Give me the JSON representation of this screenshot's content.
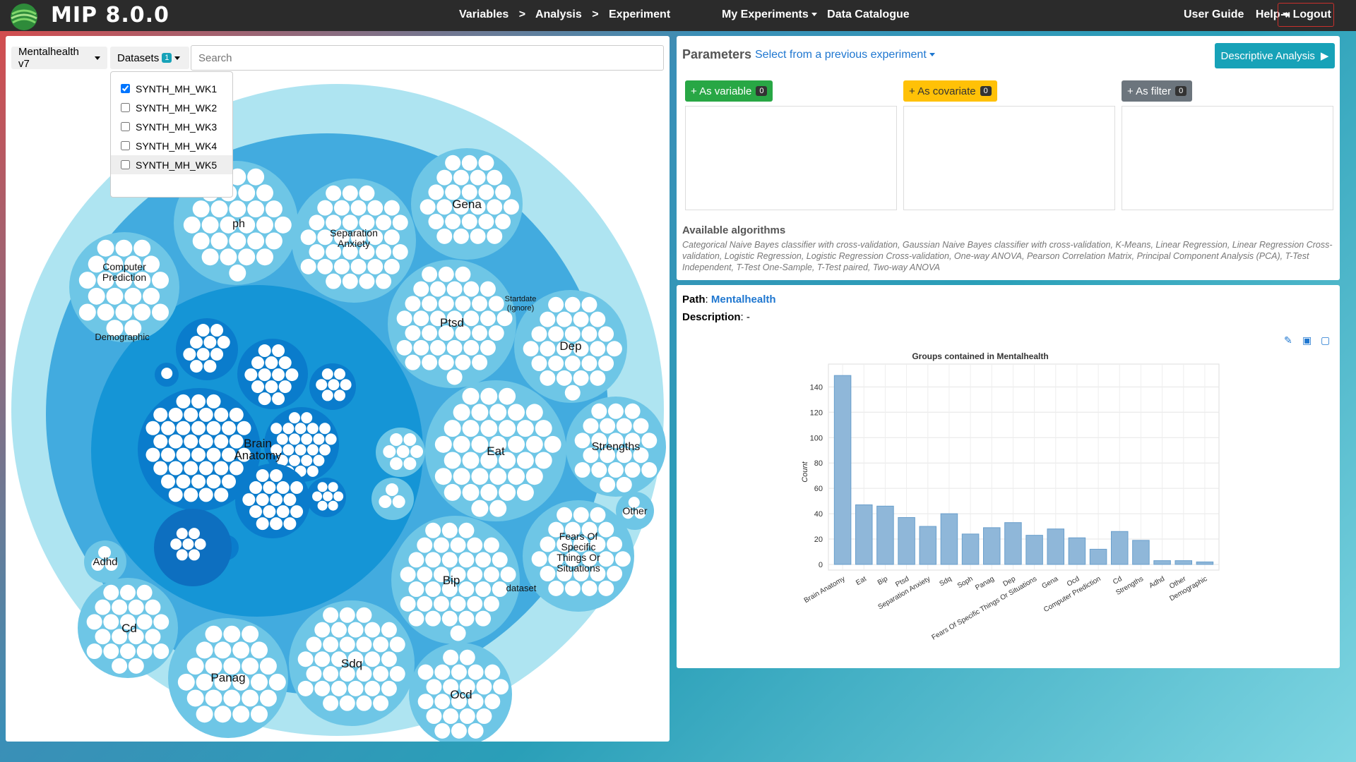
{
  "nav": {
    "brand": "MIP 8.0.0",
    "crumb_variables": "Variables",
    "crumb_sep1": ">",
    "crumb_analysis": "Analysis",
    "crumb_sep2": ">",
    "crumb_experiment": "Experiment",
    "my_experiments": "My Experiments",
    "data_catalogue": "Data Catalogue",
    "user_guide": "User Guide",
    "help": "Help",
    "logout": "Logout"
  },
  "left": {
    "pathology": "Mentalhealth v7",
    "datasets_label": "Datasets",
    "datasets_count": "1",
    "search_placeholder": "Search",
    "datasets": [
      {
        "label": "SYNTH_MH_WK1",
        "checked": true
      },
      {
        "label": "SYNTH_MH_WK2",
        "checked": false
      },
      {
        "label": "SYNTH_MH_WK3",
        "checked": false
      },
      {
        "label": "SYNTH_MH_WK4",
        "checked": false
      },
      {
        "label": "SYNTH_MH_WK5",
        "checked": false
      }
    ],
    "bubbles": {
      "computer_prediction_1": "Computer",
      "computer_prediction_2": "Prediction",
      "soph_partial": "ph",
      "separation_1": "Separation",
      "separation_2": "Anxiety",
      "gena": "Gena",
      "demographic": "Demographic",
      "ptsd": "Ptsd",
      "startdate_1": "Startdate",
      "startdate_2": "(Ignore)",
      "dep": "Dep",
      "brain_1": "Brain",
      "brain_2": "Anatomy",
      "eat": "Eat",
      "strengths": "Strengths",
      "other": "Other",
      "fears_1": "Fears Of",
      "fears_2": "Specific",
      "fears_3": "Things Or",
      "fears_4": "Situations",
      "adhd": "Adhd",
      "bip": "Bip",
      "dataset": "dataset",
      "cd": "Cd",
      "panag": "Panag",
      "sdq": "Sdq",
      "ocd": "Ocd"
    }
  },
  "params": {
    "title": "Parameters",
    "previous": "Select from a previous experiment",
    "descriptive": "Descriptive Analysis",
    "as_variable": "+ As variable",
    "as_variable_count": "0",
    "as_covariate": "+ As covariate",
    "as_covariate_count": "0",
    "as_filter": "+ As filter",
    "as_filter_count": "0",
    "alg_title": "Available algorithms",
    "alg_text": "Categorical Naive Bayes classifier with cross-validation, Gaussian Naive Bayes classifier with cross-validation, K-Means, Linear Regression, Linear Regression Cross-validation, Logistic Regression, Logistic Regression Cross-validation, One-way ANOVA, Pearson Correlation Matrix, Principal Component Analysis (PCA), T-Test Independent, T-Test One-Sample, T-Test paired, Two-way ANOVA",
    "colors": {
      "variable": "#28a745",
      "covariate": "#ffc107",
      "filter": "#6c757d"
    }
  },
  "detail": {
    "path_label": "Path",
    "path_value": "Mentalhealth",
    "desc_label": "Description",
    "desc_value": "-"
  },
  "chart_data": {
    "type": "bar",
    "title": "Groups contained in Mentalhealth",
    "ylabel": "Count",
    "xlabel": "",
    "ylim": [
      0,
      150
    ],
    "yticks": [
      0,
      20,
      40,
      60,
      80,
      100,
      120,
      140
    ],
    "categories": [
      "Brain Anatomy",
      "Eat",
      "Bip",
      "Ptsd",
      "Separation Anxiety",
      "Sdq",
      "Soph",
      "Panag",
      "Dep",
      "Fears Of Specific Things Or Situations",
      "Gena",
      "Ocd",
      "Computer Prediction",
      "Cd",
      "Strengths",
      "Adhd",
      "Other",
      "Demographic"
    ],
    "values": [
      149,
      47,
      46,
      37,
      30,
      40,
      24,
      29,
      33,
      23,
      28,
      21,
      12,
      26,
      19,
      3,
      3,
      2
    ],
    "color": "#8fb7d9"
  }
}
